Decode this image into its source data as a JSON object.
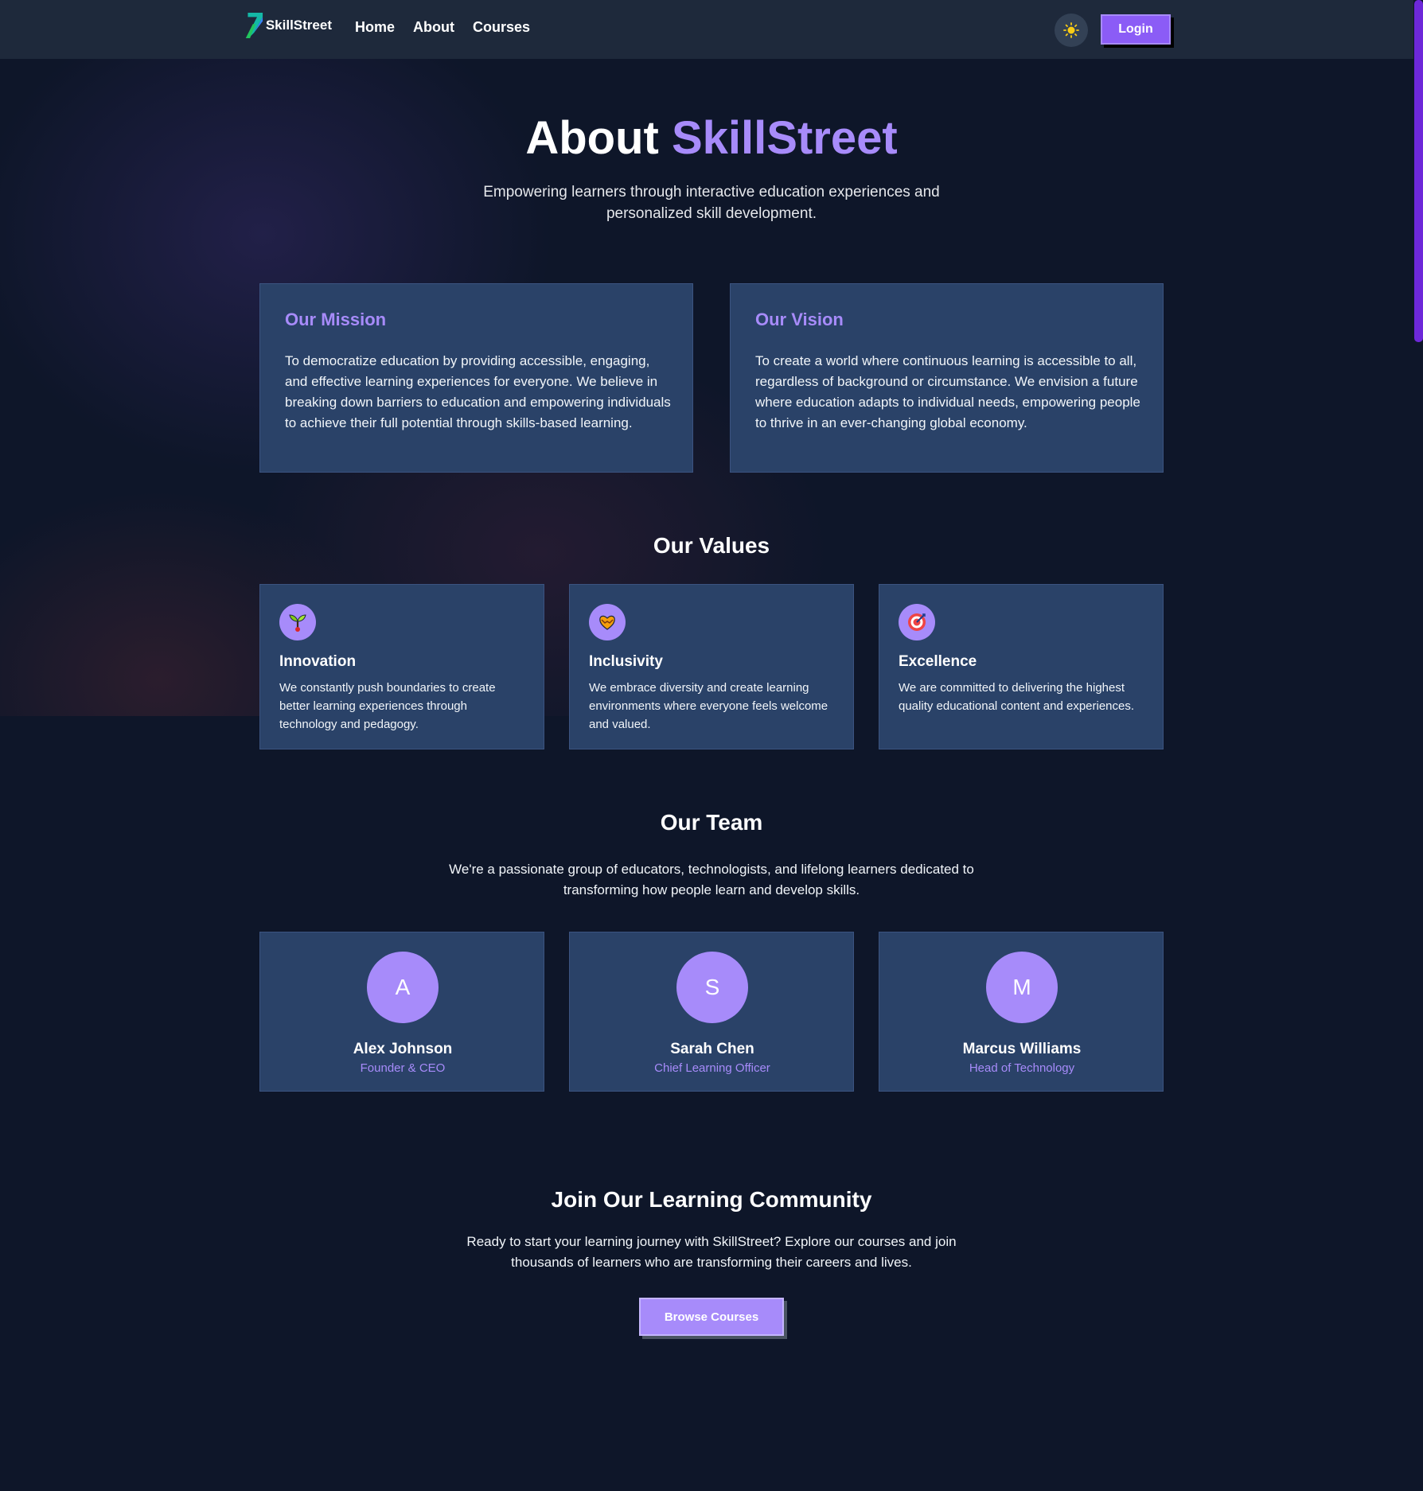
{
  "colors": {
    "accent": "#a78bfa",
    "primary_button": "#8b5cf6",
    "nav_bg": "#1e293b",
    "page_bg": "#0e1629",
    "card_bg": "#2a4268"
  },
  "nav": {
    "logo_text": "SkillStreet",
    "links": [
      "Home",
      "About",
      "Courses"
    ],
    "theme_icon": "sun-icon",
    "login_label": "Login"
  },
  "hero": {
    "title_prefix": "About",
    "title_accent": "SkillStreet",
    "subtitle": "Empowering learners through interactive education experiences and personalized skill development."
  },
  "mission": {
    "title": "Our Mission",
    "text": "To democratize education by providing accessible, engaging, and effective learning experiences for everyone. We believe in breaking down barriers to education and empowering individuals to achieve their full potential through skills-based learning."
  },
  "vision": {
    "title": "Our Vision",
    "text": "To create a world where continuous learning is accessible to all, regardless of background or circumstance. We envision a future where education adapts to individual needs, empowering people to thrive in an ever-changing global economy."
  },
  "values": {
    "title": "Our Values",
    "items": [
      {
        "icon": "seedling-icon",
        "title": "Innovation",
        "text": "We constantly push boundaries to create better learning experiences through technology and pedagogy."
      },
      {
        "icon": "heart-hands-icon",
        "title": "Inclusivity",
        "text": "We embrace diversity and create learning environments where everyone feels welcome and valued."
      },
      {
        "icon": "target-icon",
        "title": "Excellence",
        "text": "We are committed to delivering the highest quality educational content and experiences."
      }
    ]
  },
  "team": {
    "title": "Our Team",
    "subtitle": "We're a passionate group of educators, technologists, and lifelong learners dedicated to transforming how people learn and develop skills.",
    "members": [
      {
        "initial": "A",
        "name": "Alex Johnson",
        "role": "Founder & CEO"
      },
      {
        "initial": "S",
        "name": "Sarah Chen",
        "role": "Chief Learning Officer"
      },
      {
        "initial": "M",
        "name": "Marcus Williams",
        "role": "Head of Technology"
      }
    ]
  },
  "community": {
    "title": "Join Our Learning Community",
    "text": "Ready to start your learning journey with SkillStreet? Explore our courses and join thousands of learners who are transforming their careers and lives.",
    "button_label": "Browse Courses"
  }
}
